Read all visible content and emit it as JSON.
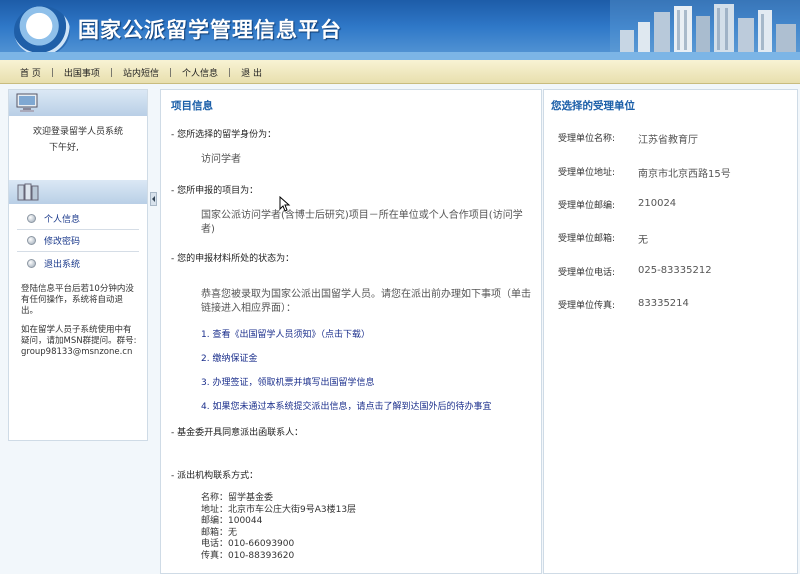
{
  "header": {
    "title": "国家公派留学管理信息平台"
  },
  "nav": {
    "items": [
      "首 页",
      "出国事项",
      "站内短信",
      "个人信息",
      "退 出"
    ]
  },
  "sidebar": {
    "welcome": "欢迎登录留学人员系统",
    "greeting": "下午好,",
    "menu": [
      "个人信息",
      "修改密码",
      "退出系统"
    ],
    "notice1": "登陆信息平台后若10分钟内没有任何操作，系统将自动退出。",
    "notice2": "如在留学人员子系统使用中有疑问，请加MSN群提问。群号:group98133@msnzone.cn"
  },
  "project": {
    "title": "项目信息",
    "q1": "- 您所选择的留学身份为：",
    "a1": "访问学者",
    "q2": "- 您所申报的项目为：",
    "a2": "国家公派访问学者(含博士后研究)项目－所在单位或个人合作项目(访问学者)",
    "q3": "- 您的申报材料所处的状态为：",
    "a3": "恭喜您被录取为国家公派出国留学人员。请您在派出前办理如下事项（单击链接进入相应界面）：",
    "links": [
      "1. 查看《出国留学人员须知》（点击下载）",
      "2. 缴纳保证金",
      "3. 办理签证，领取机票并填写出国留学信息",
      "4. 如果您未通过本系统提交派出信息，请点击了解到达国外后的待办事宜"
    ],
    "q4": "- 基金委开具同意派出函联系人：",
    "q5": "- 派出机构联系方式：",
    "contact": [
      "名称：留学基金委",
      "地址：北京市车公庄大街9号A3楼13层",
      "邮编：100044",
      "邮箱：无",
      "电话：010-66093900",
      "传真：010-88393620"
    ]
  },
  "unit": {
    "title": "您选择的受理单位",
    "rows": [
      {
        "k": "受理单位名称:",
        "v": "江苏省教育厅"
      },
      {
        "k": "受理单位地址:",
        "v": "南京市北京西路15号"
      },
      {
        "k": "受理单位邮编:",
        "v": "210024"
      },
      {
        "k": "受理单位邮箱:",
        "v": "无"
      },
      {
        "k": "受理单位电话:",
        "v": "025-83335212"
      },
      {
        "k": "受理单位传真:",
        "v": "83335214"
      }
    ]
  }
}
